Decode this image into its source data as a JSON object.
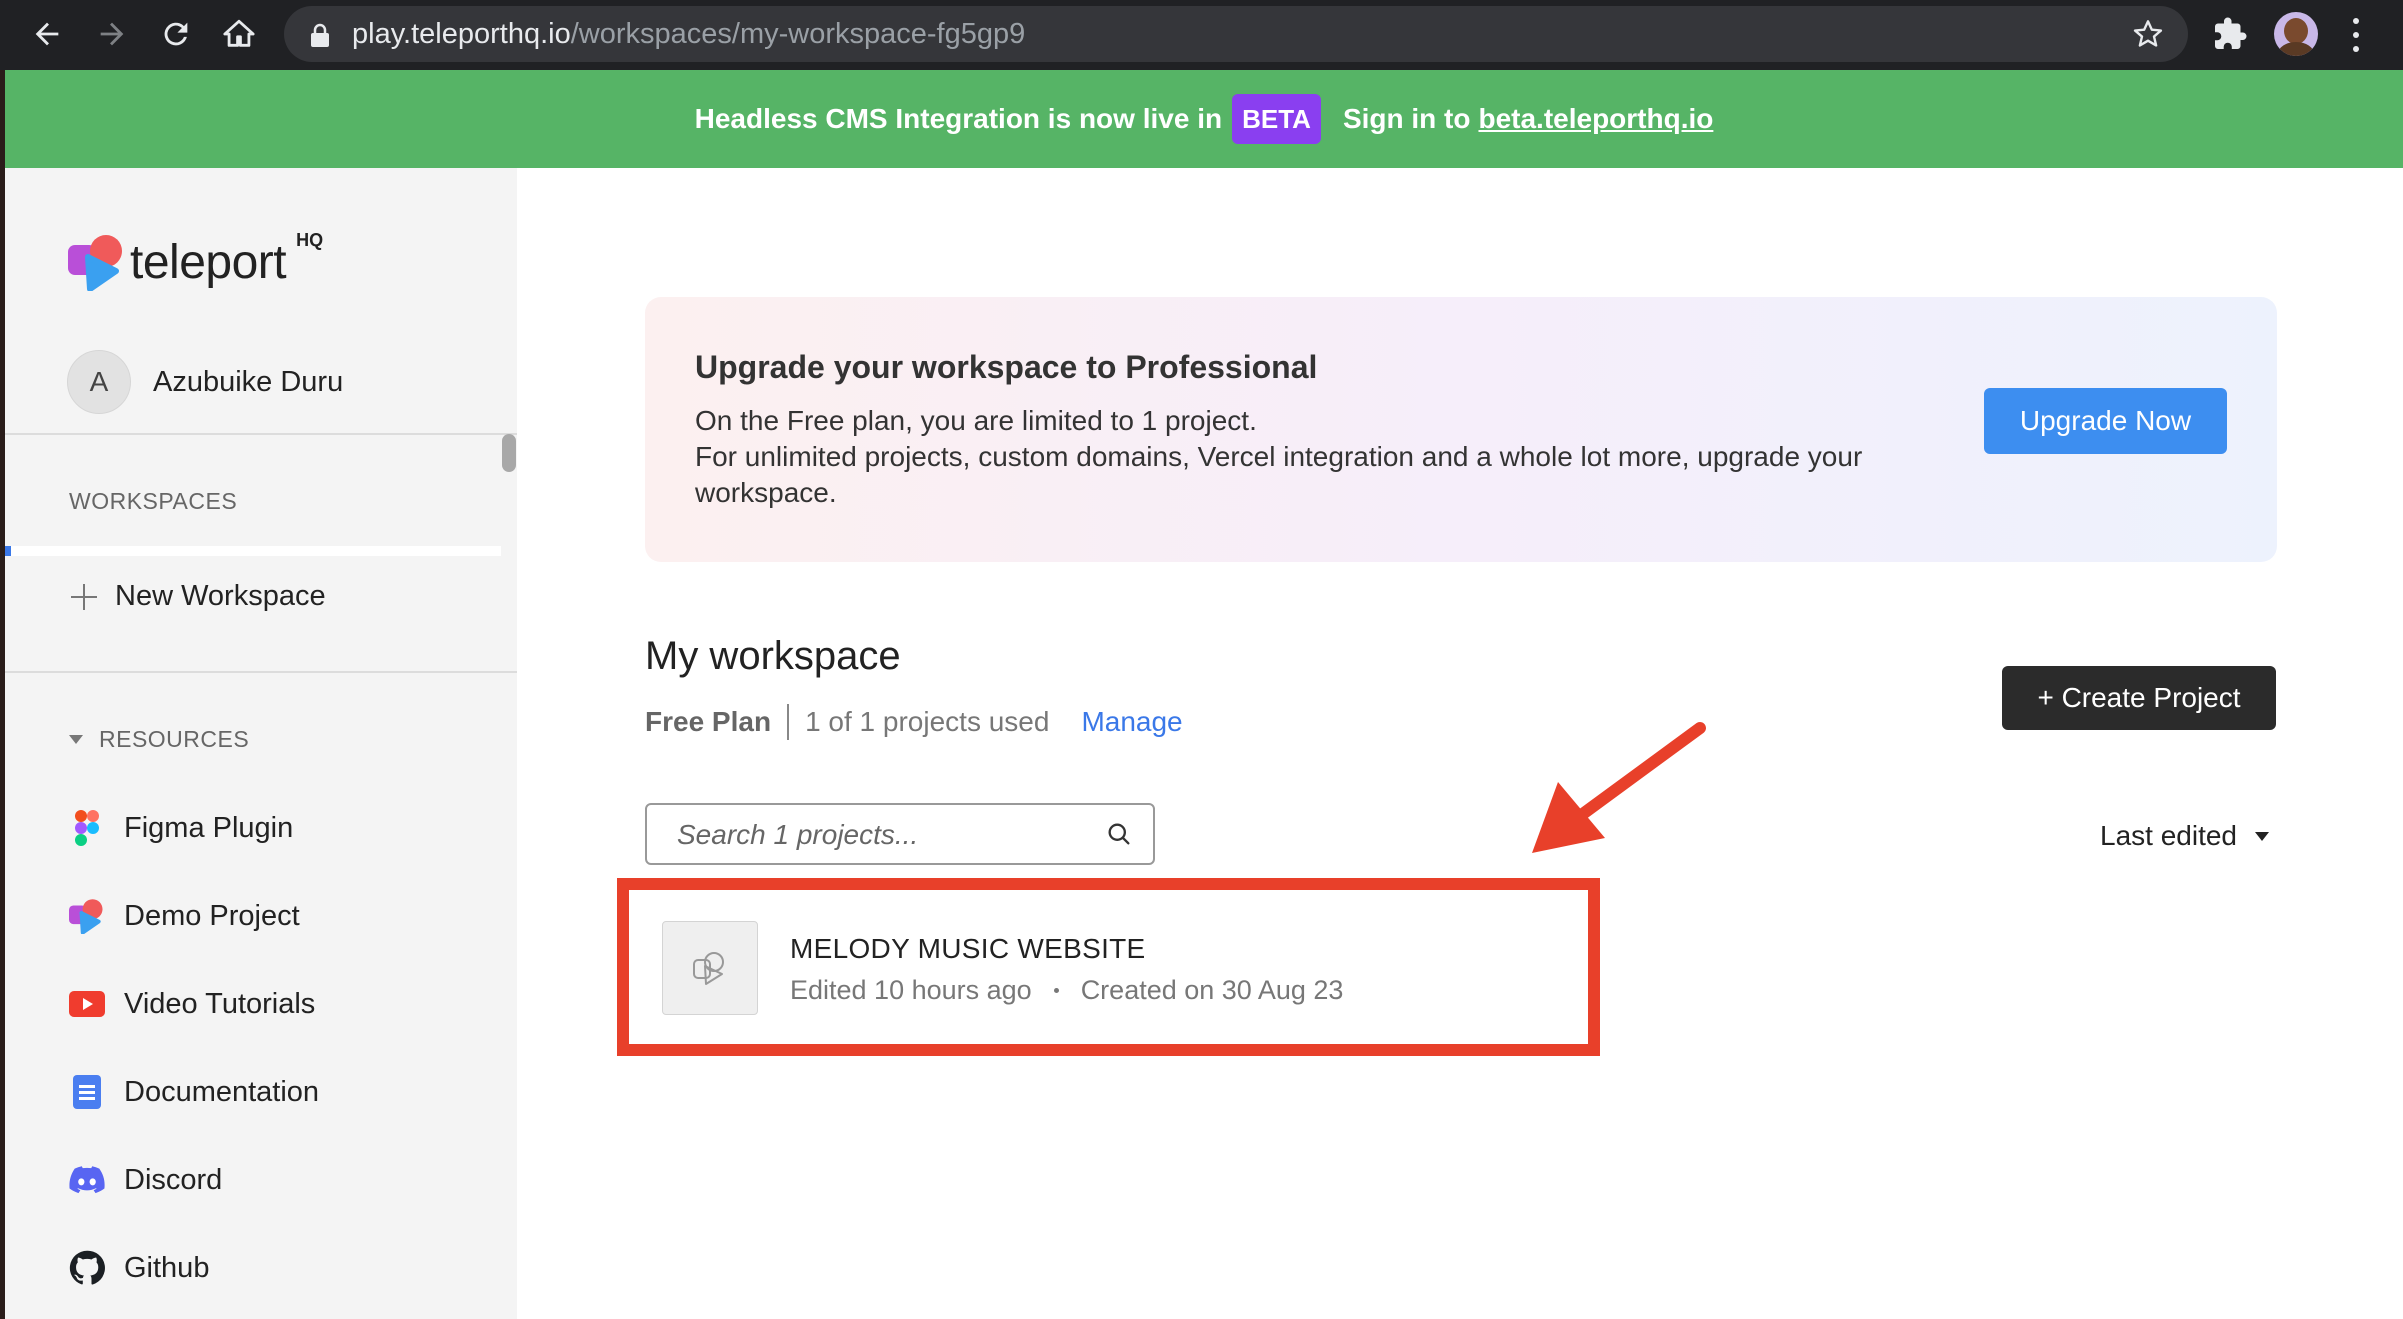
{
  "browser": {
    "url_host": "play.teleporthq.io",
    "url_path": "/workspaces/my-workspace-fg5gp9"
  },
  "banner": {
    "text": "Headless CMS Integration is now live in",
    "badge": "BETA",
    "signin_text": "Sign in to",
    "link": "beta.teleporthq.io",
    "color": "#56b466"
  },
  "sidebar": {
    "logo_text": "teleport",
    "logo_sup": "HQ",
    "user_initial": "A",
    "user_name": "Azubuike Duru",
    "workspaces_label": "WORKSPACES",
    "new_workspace": "New Workspace",
    "resources_label": "RESOURCES",
    "resources": [
      {
        "label": "Figma Plugin",
        "icon": "figma-icon"
      },
      {
        "label": "Demo Project",
        "icon": "teleport-icon"
      },
      {
        "label": "Video Tutorials",
        "icon": "youtube-icon"
      },
      {
        "label": "Documentation",
        "icon": "document-icon"
      },
      {
        "label": "Discord",
        "icon": "discord-icon"
      },
      {
        "label": "Github",
        "icon": "github-icon"
      }
    ]
  },
  "upgrade": {
    "title": "Upgrade your workspace to Professional",
    "line1": "On the Free plan, you are limited to 1 project.",
    "line2": "For unlimited projects, custom domains, Vercel integration and a whole lot more, upgrade your workspace.",
    "button": "Upgrade Now",
    "accent": "#3d8ef0"
  },
  "workspace": {
    "title": "My workspace",
    "plan": "Free Plan",
    "usage": "1 of 1 projects used",
    "manage": "Manage",
    "create_button": "+ Create Project",
    "search_placeholder": "Search 1 projects...",
    "sort_label": "Last edited"
  },
  "projects": [
    {
      "name": "MELODY MUSIC WEBSITE",
      "edited": "Edited 10 hours ago",
      "created": "Created on 30 Aug 23"
    }
  ],
  "annotation": {
    "highlight_color": "#e8402a"
  }
}
